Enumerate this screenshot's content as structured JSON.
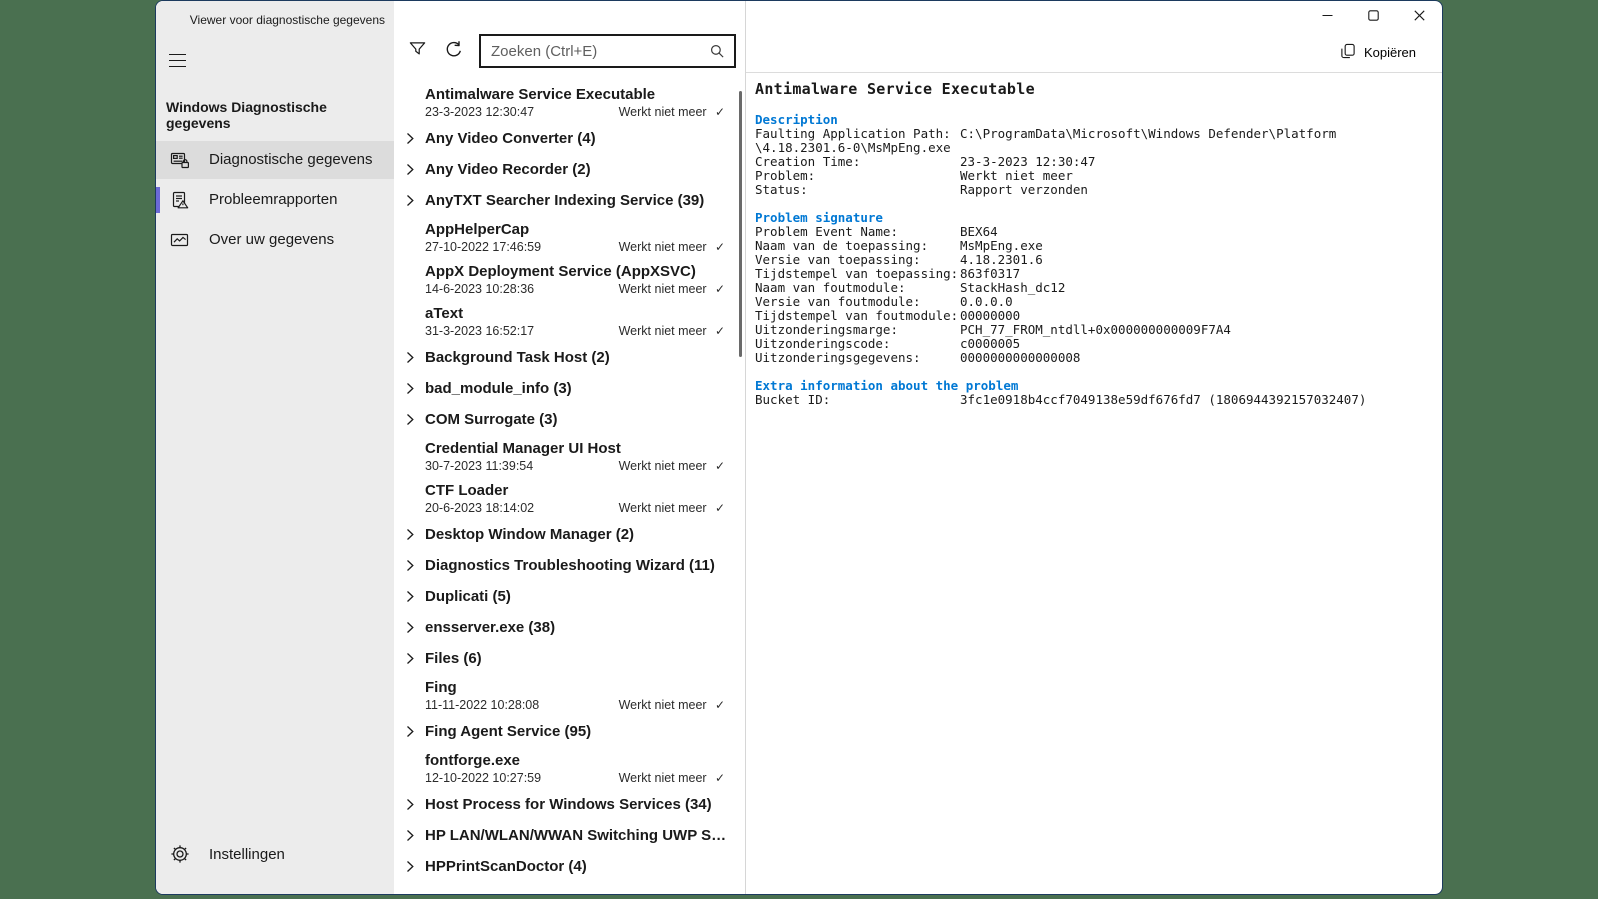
{
  "colors": {
    "desktop": "#4a7050",
    "accent": "#6b69d6",
    "heading-blue": "#0078d4",
    "win-border": "#1c3a5e"
  },
  "icons": {
    "check": "✓",
    "named": [
      "hamburger-menu-icon",
      "diagnostic-data-icon",
      "problem-reports-icon",
      "about-data-icon",
      "settings-gear-icon",
      "filter-icon",
      "refresh-icon",
      "search-icon",
      "chevron-right-icon",
      "copy-icon",
      "minimize-icon",
      "maximize-icon",
      "close-icon"
    ]
  },
  "sidebar": {
    "app_title": "Viewer voor diagnostische gegevens",
    "section_heading": "Windows Diagnostische gegevens",
    "items": [
      {
        "label": "Diagnostische gegevens",
        "icon": "diagnostic-data-icon",
        "highlighted": true,
        "selected": false
      },
      {
        "label": "Probleemrapporten",
        "icon": "problem-reports-icon",
        "highlighted": false,
        "selected": true
      },
      {
        "label": "Over uw gegevens",
        "icon": "about-data-icon",
        "highlighted": false,
        "selected": false
      }
    ],
    "settings_label": "Instellingen"
  },
  "search": {
    "placeholder": "Zoeken (Ctrl+E)"
  },
  "report_list": [
    {
      "type": "report",
      "title": "Antimalware Service Executable",
      "date": "23-3-2023 12:30:47",
      "status": "Werkt niet meer"
    },
    {
      "type": "group",
      "title": "Any Video Converter (4)"
    },
    {
      "type": "group",
      "title": "Any Video Recorder (2)"
    },
    {
      "type": "group",
      "title": "AnyTXT Searcher Indexing Service (39)"
    },
    {
      "type": "report",
      "title": "AppHelperCap",
      "date": "27-10-2022 17:46:59",
      "status": "Werkt niet meer"
    },
    {
      "type": "report",
      "title": "AppX Deployment Service (AppXSVC)",
      "date": "14-6-2023 10:28:36",
      "status": "Werkt niet meer"
    },
    {
      "type": "report",
      "title": "aText",
      "date": "31-3-2023 16:52:17",
      "status": "Werkt niet meer"
    },
    {
      "type": "group",
      "title": "Background Task Host (2)"
    },
    {
      "type": "group",
      "title": "bad_module_info (3)"
    },
    {
      "type": "group",
      "title": "COM Surrogate (3)"
    },
    {
      "type": "report",
      "title": "Credential Manager UI Host",
      "date": "30-7-2023 11:39:54",
      "status": "Werkt niet meer"
    },
    {
      "type": "report",
      "title": "CTF Loader",
      "date": "20-6-2023 18:14:02",
      "status": "Werkt niet meer"
    },
    {
      "type": "group",
      "title": "Desktop Window Manager (2)"
    },
    {
      "type": "group",
      "title": "Diagnostics Troubleshooting Wizard (11)"
    },
    {
      "type": "group",
      "title": "Duplicati (5)"
    },
    {
      "type": "group",
      "title": "ensserver.exe (38)"
    },
    {
      "type": "group",
      "title": "Files (6)"
    },
    {
      "type": "report",
      "title": "Fing",
      "date": "11-11-2022 10:28:08",
      "status": "Werkt niet meer"
    },
    {
      "type": "group",
      "title": "Fing Agent Service (95)"
    },
    {
      "type": "report",
      "title": "fontforge.exe",
      "date": "12-10-2022 10:27:59",
      "status": "Werkt niet meer"
    },
    {
      "type": "group",
      "title": "Host Process for Windows Services (34)"
    },
    {
      "type": "group",
      "title": "HP LAN/WLAN/WWAN Switching UWP Servic..."
    },
    {
      "type": "group",
      "title": "HPPrintScanDoctor (4)"
    }
  ],
  "detail": {
    "copy_label": "Kopiëren",
    "title": "Antimalware Service Executable",
    "sections": [
      {
        "heading": "Description",
        "rows": [
          {
            "label": "Faulting Application Path:",
            "value": "C:\\ProgramData\\Microsoft\\Windows Defender\\Platform"
          },
          {
            "label": "",
            "value": "\\4.18.2301.6-0\\MsMpEng.exe"
          },
          {
            "label": "Creation Time:",
            "value": "23-3-2023 12:30:47"
          },
          {
            "label": "Problem:",
            "value": "Werkt niet meer"
          },
          {
            "label": "Status:",
            "value": "Rapport verzonden"
          }
        ]
      },
      {
        "heading": "Problem signature",
        "rows": [
          {
            "label": "Problem Event Name:",
            "value": "BEX64"
          },
          {
            "label": "Naam van de toepassing:",
            "value": "MsMpEng.exe"
          },
          {
            "label": "Versie van toepassing:",
            "value": "4.18.2301.6"
          },
          {
            "label": "Tijdstempel van toepassing:",
            "value": "863f0317"
          },
          {
            "label": "Naam van foutmodule:",
            "value": "StackHash_dc12"
          },
          {
            "label": "Versie van foutmodule:",
            "value": "0.0.0.0"
          },
          {
            "label": "Tijdstempel van foutmodule:",
            "value": "00000000"
          },
          {
            "label": "Uitzonderingsmarge:",
            "value": "PCH_77_FROM_ntdll+0x000000000009F7A4"
          },
          {
            "label": "Uitzonderingscode:",
            "value": "c0000005"
          },
          {
            "label": "Uitzonderingsgegevens:",
            "value": "0000000000000008"
          }
        ]
      },
      {
        "heading": "Extra information about the problem",
        "rows": [
          {
            "label": "Bucket ID:",
            "value": "3fc1e0918b4ccf7049138e59df676fd7 (1806944392157032407)"
          }
        ]
      }
    ]
  }
}
